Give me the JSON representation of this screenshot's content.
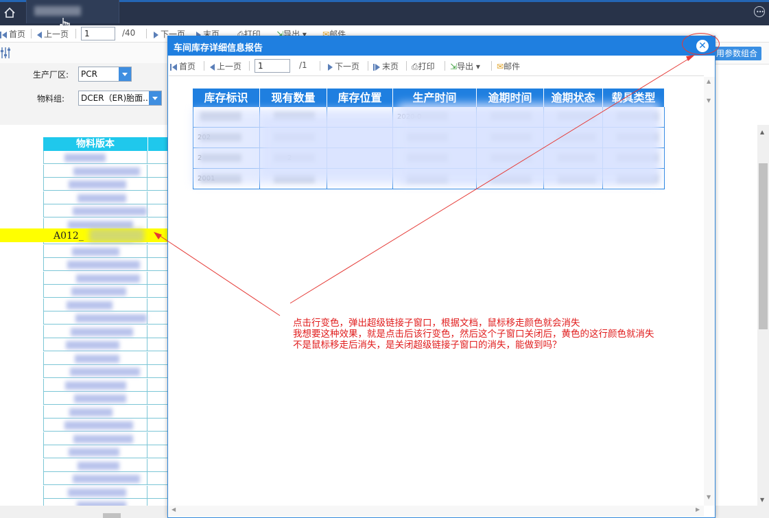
{
  "app": {
    "top_tab_label": "",
    "colors": {
      "top_bar": "#283349",
      "accent": "#1f7fe0",
      "highlight": "#ffff00",
      "annotation": "#e01b1b"
    }
  },
  "toolbar": {
    "first": "首页",
    "prev": "上一页",
    "page_value": "1",
    "page_total": "/40",
    "next": "下一页",
    "last": "末页",
    "print": "打印",
    "export": "导出",
    "email": "邮件"
  },
  "filters": {
    "plant_label": "生产厂区:",
    "plant_value": "PCR",
    "group_label": "物料组:",
    "group_value": "DCER（ER)胎面..."
  },
  "left_table": {
    "header": "物料版本",
    "highlighted_row_text": "A012_"
  },
  "right_button_label": "用参数组合",
  "modal": {
    "title": "车间库存详细信息报告",
    "toolbar": {
      "first": "首页",
      "prev": "上一页",
      "page_value": "1",
      "page_total": "/1",
      "next": "下一页",
      "last": "末页",
      "print": "打印",
      "export": "导出",
      "email": "邮件"
    },
    "table": {
      "headers": [
        "库存标识",
        "现有数量",
        "库存位置",
        "生产时间",
        "逾期时间",
        "逾期状态",
        "载具类型"
      ],
      "rows": [
        [
          "",
          "",
          "",
          "2020-0",
          "",
          "",
          ""
        ],
        [
          "202",
          "",
          "",
          "",
          "",
          "",
          ""
        ],
        [
          "2",
          "2",
          "",
          "",
          "",
          "",
          ""
        ],
        [
          "2001",
          "",
          "",
          "",
          "",
          "",
          ""
        ]
      ]
    }
  },
  "annotation": {
    "line1": "点击行变色，弹出超级链接子窗口，根据文档，鼠标移走颜色就会消失",
    "line2": "我想要这种效果，就是点击后该行变色，然后这个子窗口关闭后，黄色的这行颜色就消失",
    "line3": "不是鼠标移走后消失，是关闭超级链接子窗口的消失，能做到吗？"
  }
}
